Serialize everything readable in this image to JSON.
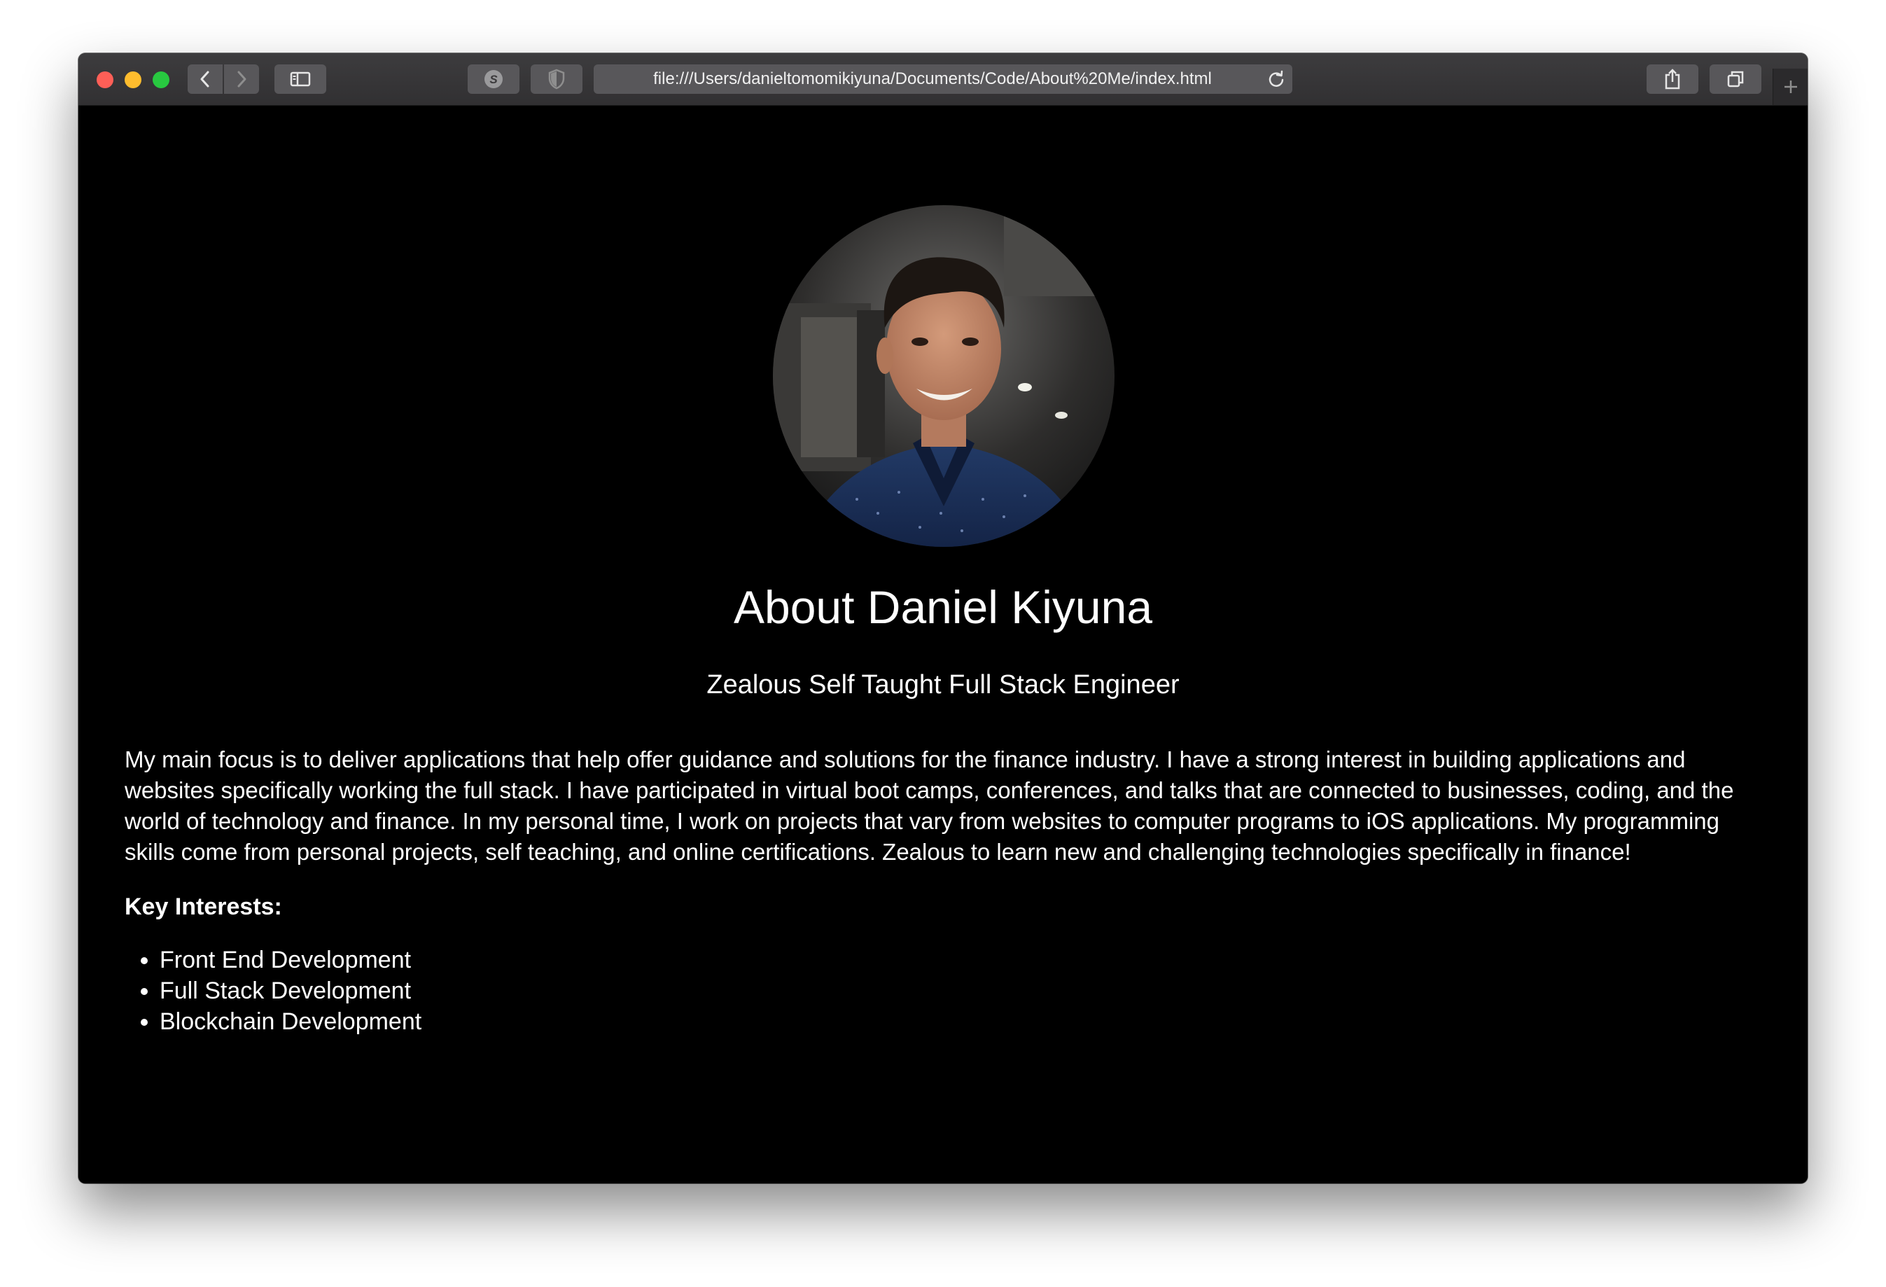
{
  "browser": {
    "url": "file:///Users/danieltomomikiyuna/Documents/Code/About%20Me/index.html",
    "colors": {
      "close": "#fe5f57",
      "minimize": "#febc2e",
      "zoom": "#28c840",
      "toolbar": "#3a393b"
    },
    "icons": [
      "back-icon",
      "forward-icon",
      "sidebar-icon",
      "extension-s-icon",
      "shield-icon",
      "reload-icon",
      "share-icon",
      "tabs-overview-icon",
      "plus-icon"
    ]
  },
  "page": {
    "background": "#000000",
    "text_color": "#ffffff",
    "title": "About Daniel Kiyuna",
    "subtitle": "Zealous Self Taught Full Stack Engineer",
    "bio": "My main focus is to deliver applications that help offer guidance and solutions for the finance industry. I have a strong interest in building applications and websites specifically working the full stack. I have participated in virtual boot camps, conferences, and talks that are connected to businesses, coding, and the world of technology and finance. In my personal time, I work on projects that vary from websites to computer programs to iOS applications. My programming skills come from personal projects, self teaching, and online certifications. Zealous to learn new and challenging technologies specifically in finance!",
    "interests_title": "Key Interests:",
    "interests": [
      "Front End Development",
      "Full Stack Development",
      "Blockchain Development"
    ]
  }
}
